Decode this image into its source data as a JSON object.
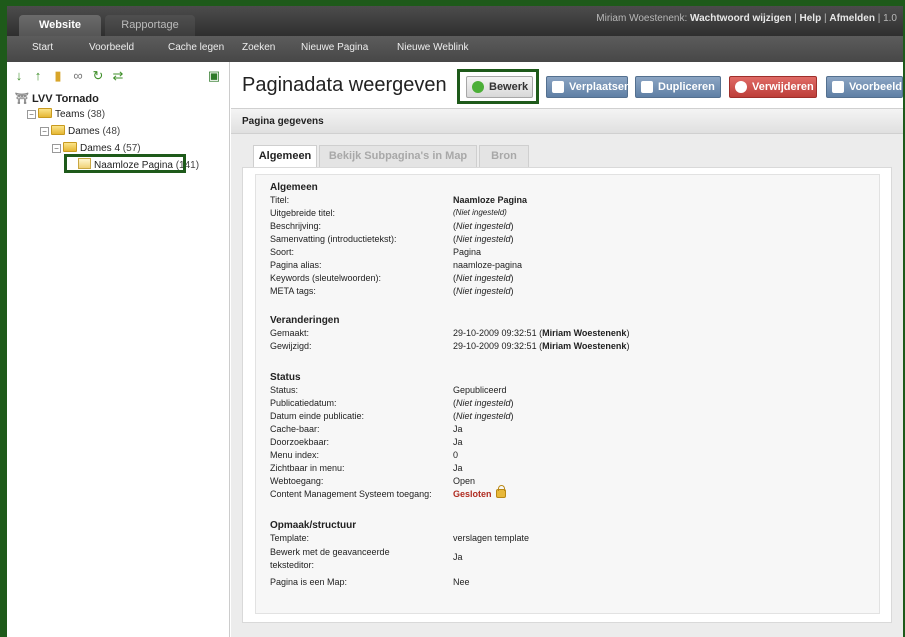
{
  "top_tabs": {
    "website": "Website",
    "rapportage": "Rapportage"
  },
  "user_bar": {
    "user": "Miriam Woestenenk:",
    "change_password": "Wachtwoord wijzigen",
    "sep1": "|",
    "help": "Help",
    "sep2": "|",
    "logout": "Afmelden",
    "sep3": "|",
    "version": "1.0"
  },
  "sub_nav": [
    "Start",
    "Voorbeeld",
    "Cache legen",
    "Zoeken",
    "Nieuwe Pagina",
    "Nieuwe Weblink"
  ],
  "tree": {
    "root": "LVV Tornado",
    "teams": {
      "label": "Teams",
      "count": "(38)"
    },
    "dames": {
      "label": "Dames",
      "count": "(48)"
    },
    "dames4": {
      "label": "Dames 4",
      "count": "(57)"
    },
    "page": {
      "label": "Naamloze Pagina",
      "count": "(141)"
    }
  },
  "page_title": "Paginadata weergeven",
  "buttons": {
    "edit": "Bewerk",
    "move": "Verplaatsen",
    "duplicate": "Dupliceren",
    "delete": "Verwijderen",
    "preview": "Voorbeeld"
  },
  "panel_title": "Pagina gegevens",
  "tabs": [
    "Algemeen",
    "Bekijk Subpagina's in Map",
    "Bron"
  ],
  "sections": {
    "algemeen": {
      "title": "Algemeen",
      "rows": [
        {
          "k": "Titel:",
          "v": "Naamloze Pagina"
        },
        {
          "k": "Uitgebreide titel:",
          "v": "(Niet ingesteld)"
        },
        {
          "k": "Beschrijving:",
          "v": "Niet ingesteld"
        },
        {
          "k": "Samenvatting (introductietekst):",
          "v": "Niet ingesteld"
        },
        {
          "k": "Soort:",
          "v": "Pagina"
        },
        {
          "k": "Pagina alias:",
          "v": "naamloze-pagina"
        },
        {
          "k": "Keywords (sleutelwoorden):",
          "v": "Niet ingesteld"
        },
        {
          "k": "META tags:",
          "v": "Niet ingesteld"
        }
      ]
    },
    "veranderingen": {
      "title": "Veranderingen",
      "rows": [
        {
          "k": "Gemaakt:",
          "v": "29-10-2009 09:32:51",
          "who": "Miriam Woestenenk"
        },
        {
          "k": "Gewijzigd:",
          "v": "29-10-2009 09:32:51",
          "who": "Miriam Woestenenk"
        }
      ]
    },
    "status": {
      "title": "Status",
      "rows": [
        {
          "k": "Status:",
          "v": "Gepubliceerd"
        },
        {
          "k": "Publicatiedatum:",
          "v": "Niet ingesteld"
        },
        {
          "k": "Datum einde publicatie:",
          "v": "Niet ingesteld"
        },
        {
          "k": "Cache-baar:",
          "v": "Ja"
        },
        {
          "k": "Doorzoekbaar:",
          "v": "Ja"
        },
        {
          "k": "Menu index:",
          "v": "0"
        },
        {
          "k": "Zichtbaar in menu:",
          "v": "Ja"
        },
        {
          "k": "Webtoegang:",
          "v": "Open"
        },
        {
          "k": "Content Management Systeem toegang:",
          "v": "Gesloten"
        }
      ]
    },
    "opmaak": {
      "title": "Opmaak/structuur",
      "rows": [
        {
          "k": "Template:",
          "v": "verslagen template"
        },
        {
          "k": "Bewerk met de geavanceerde teksteditor:",
          "v": "Ja"
        },
        {
          "k": "Pagina is een Map:",
          "v": "Nee"
        }
      ]
    }
  },
  "colors": {
    "frame": "#1e5a1a",
    "header": "#3a3a3a",
    "edit_icon": "#4caf38",
    "blue_btn": "#6f8eb3",
    "red_btn": "#cf524d",
    "closed": "#b02c21"
  }
}
